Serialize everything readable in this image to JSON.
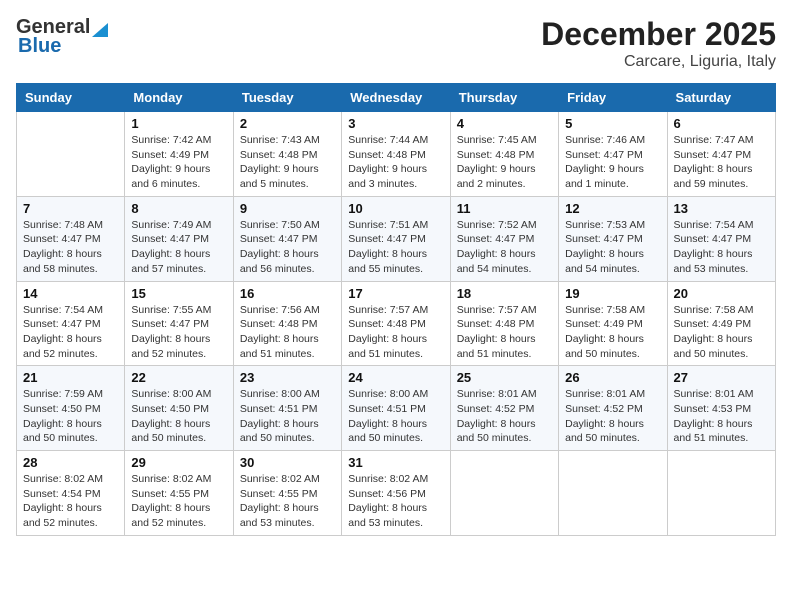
{
  "header": {
    "logo_general": "General",
    "logo_blue": "Blue",
    "month_title": "December 2025",
    "location": "Carcare, Liguria, Italy"
  },
  "days_of_week": [
    "Sunday",
    "Monday",
    "Tuesday",
    "Wednesday",
    "Thursday",
    "Friday",
    "Saturday"
  ],
  "weeks": [
    [
      {
        "day": "",
        "info": ""
      },
      {
        "day": "1",
        "info": "Sunrise: 7:42 AM\nSunset: 4:49 PM\nDaylight: 9 hours\nand 6 minutes."
      },
      {
        "day": "2",
        "info": "Sunrise: 7:43 AM\nSunset: 4:48 PM\nDaylight: 9 hours\nand 5 minutes."
      },
      {
        "day": "3",
        "info": "Sunrise: 7:44 AM\nSunset: 4:48 PM\nDaylight: 9 hours\nand 3 minutes."
      },
      {
        "day": "4",
        "info": "Sunrise: 7:45 AM\nSunset: 4:48 PM\nDaylight: 9 hours\nand 2 minutes."
      },
      {
        "day": "5",
        "info": "Sunrise: 7:46 AM\nSunset: 4:47 PM\nDaylight: 9 hours\nand 1 minute."
      },
      {
        "day": "6",
        "info": "Sunrise: 7:47 AM\nSunset: 4:47 PM\nDaylight: 8 hours\nand 59 minutes."
      }
    ],
    [
      {
        "day": "7",
        "info": "Sunrise: 7:48 AM\nSunset: 4:47 PM\nDaylight: 8 hours\nand 58 minutes."
      },
      {
        "day": "8",
        "info": "Sunrise: 7:49 AM\nSunset: 4:47 PM\nDaylight: 8 hours\nand 57 minutes."
      },
      {
        "day": "9",
        "info": "Sunrise: 7:50 AM\nSunset: 4:47 PM\nDaylight: 8 hours\nand 56 minutes."
      },
      {
        "day": "10",
        "info": "Sunrise: 7:51 AM\nSunset: 4:47 PM\nDaylight: 8 hours\nand 55 minutes."
      },
      {
        "day": "11",
        "info": "Sunrise: 7:52 AM\nSunset: 4:47 PM\nDaylight: 8 hours\nand 54 minutes."
      },
      {
        "day": "12",
        "info": "Sunrise: 7:53 AM\nSunset: 4:47 PM\nDaylight: 8 hours\nand 54 minutes."
      },
      {
        "day": "13",
        "info": "Sunrise: 7:54 AM\nSunset: 4:47 PM\nDaylight: 8 hours\nand 53 minutes."
      }
    ],
    [
      {
        "day": "14",
        "info": "Sunrise: 7:54 AM\nSunset: 4:47 PM\nDaylight: 8 hours\nand 52 minutes."
      },
      {
        "day": "15",
        "info": "Sunrise: 7:55 AM\nSunset: 4:47 PM\nDaylight: 8 hours\nand 52 minutes."
      },
      {
        "day": "16",
        "info": "Sunrise: 7:56 AM\nSunset: 4:48 PM\nDaylight: 8 hours\nand 51 minutes."
      },
      {
        "day": "17",
        "info": "Sunrise: 7:57 AM\nSunset: 4:48 PM\nDaylight: 8 hours\nand 51 minutes."
      },
      {
        "day": "18",
        "info": "Sunrise: 7:57 AM\nSunset: 4:48 PM\nDaylight: 8 hours\nand 51 minutes."
      },
      {
        "day": "19",
        "info": "Sunrise: 7:58 AM\nSunset: 4:49 PM\nDaylight: 8 hours\nand 50 minutes."
      },
      {
        "day": "20",
        "info": "Sunrise: 7:58 AM\nSunset: 4:49 PM\nDaylight: 8 hours\nand 50 minutes."
      }
    ],
    [
      {
        "day": "21",
        "info": "Sunrise: 7:59 AM\nSunset: 4:50 PM\nDaylight: 8 hours\nand 50 minutes."
      },
      {
        "day": "22",
        "info": "Sunrise: 8:00 AM\nSunset: 4:50 PM\nDaylight: 8 hours\nand 50 minutes."
      },
      {
        "day": "23",
        "info": "Sunrise: 8:00 AM\nSunset: 4:51 PM\nDaylight: 8 hours\nand 50 minutes."
      },
      {
        "day": "24",
        "info": "Sunrise: 8:00 AM\nSunset: 4:51 PM\nDaylight: 8 hours\nand 50 minutes."
      },
      {
        "day": "25",
        "info": "Sunrise: 8:01 AM\nSunset: 4:52 PM\nDaylight: 8 hours\nand 50 minutes."
      },
      {
        "day": "26",
        "info": "Sunrise: 8:01 AM\nSunset: 4:52 PM\nDaylight: 8 hours\nand 50 minutes."
      },
      {
        "day": "27",
        "info": "Sunrise: 8:01 AM\nSunset: 4:53 PM\nDaylight: 8 hours\nand 51 minutes."
      }
    ],
    [
      {
        "day": "28",
        "info": "Sunrise: 8:02 AM\nSunset: 4:54 PM\nDaylight: 8 hours\nand 52 minutes."
      },
      {
        "day": "29",
        "info": "Sunrise: 8:02 AM\nSunset: 4:55 PM\nDaylight: 8 hours\nand 52 minutes."
      },
      {
        "day": "30",
        "info": "Sunrise: 8:02 AM\nSunset: 4:55 PM\nDaylight: 8 hours\nand 53 minutes."
      },
      {
        "day": "31",
        "info": "Sunrise: 8:02 AM\nSunset: 4:56 PM\nDaylight: 8 hours\nand 53 minutes."
      },
      {
        "day": "",
        "info": ""
      },
      {
        "day": "",
        "info": ""
      },
      {
        "day": "",
        "info": ""
      }
    ]
  ]
}
